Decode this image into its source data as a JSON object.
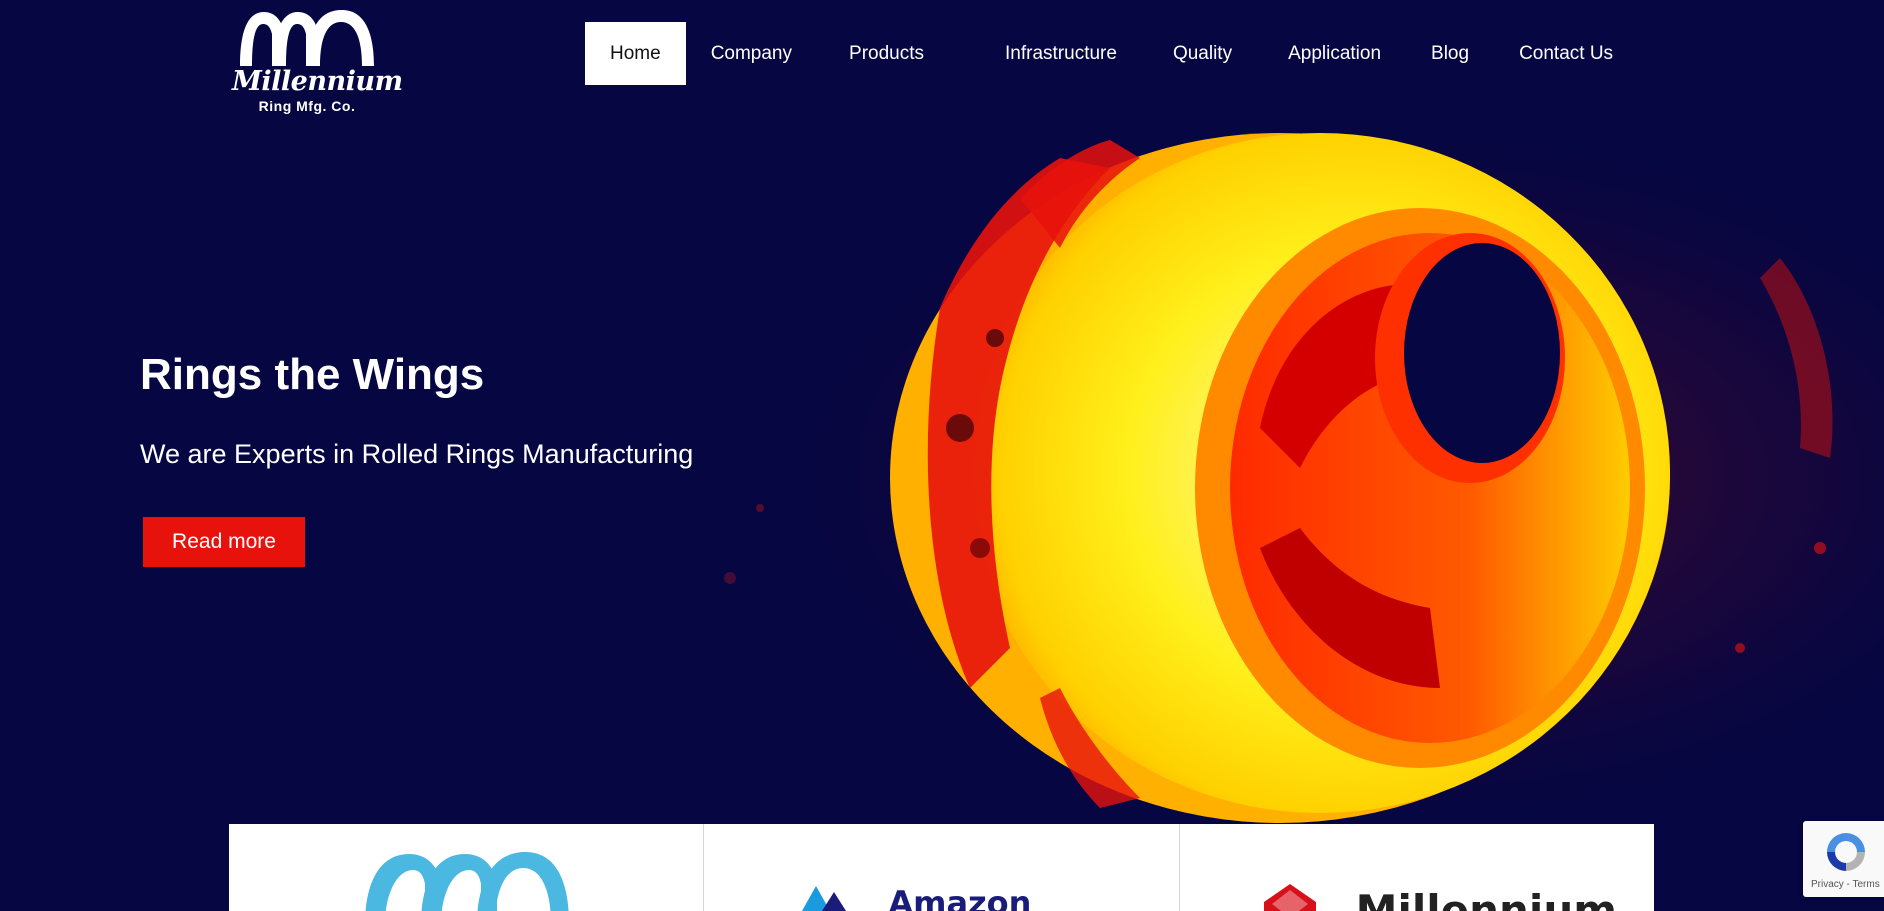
{
  "brand": {
    "name": "Millennium",
    "tagline": "Ring Mfg. Co."
  },
  "nav": {
    "items": [
      {
        "label": "Home",
        "active": true
      },
      {
        "label": "Company"
      },
      {
        "label": "Products"
      },
      {
        "label": "Infrastructure"
      },
      {
        "label": "Quality"
      },
      {
        "label": "Application"
      },
      {
        "label": "Blog"
      },
      {
        "label": "Contact Us"
      }
    ]
  },
  "hero": {
    "title": "Rings the Wings",
    "subtitle": "We are Experts in Rolled Rings Manufacturing",
    "cta_label": "Read more"
  },
  "partners": {
    "items": [
      {
        "name": "millennium-rings-logo"
      },
      {
        "label": "Amazon"
      },
      {
        "label": "Millennium"
      }
    ]
  },
  "recaptcha": {
    "links": "Privacy - Terms"
  },
  "colors": {
    "background": "#050642",
    "accent": "#e8120c",
    "nav_active_bg": "#ffffff",
    "ring_yellow": "#ffef1a",
    "ring_red": "#e8120c"
  }
}
